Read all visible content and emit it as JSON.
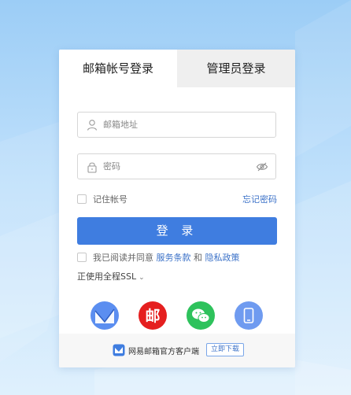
{
  "tabs": {
    "mail_account_login": "邮箱帐号登录",
    "admin_login": "管理员登录"
  },
  "form": {
    "email_placeholder": "邮箱地址",
    "password_placeholder": "密码",
    "remember_label": "记住帐号",
    "forgot_password": "忘记密码",
    "login_button": "登 录"
  },
  "agreement": {
    "prefix": "我已阅读并同意 ",
    "terms": "服务条款",
    "and": " 和 ",
    "privacy": "隐私政策"
  },
  "ssl": {
    "label": "正使用全程SSL",
    "chevron": "⌄"
  },
  "apps": [
    {
      "icon": "mail-master-icon",
      "glyph": ""
    },
    {
      "icon": "netease-163-icon",
      "glyph": "邮"
    },
    {
      "icon": "wechat-icon",
      "glyph": ""
    },
    {
      "icon": "mobile-phone-icon",
      "glyph": ""
    }
  ],
  "footer": {
    "text": "网易邮箱官方客户端",
    "download_button": "立即下载"
  },
  "colors": {
    "accent": "#3f7de0",
    "link": "#3c72c8",
    "red_163": "#e51f1f",
    "wechat_green": "#2ec25c",
    "mobile_blue": "#6f9bf0"
  }
}
